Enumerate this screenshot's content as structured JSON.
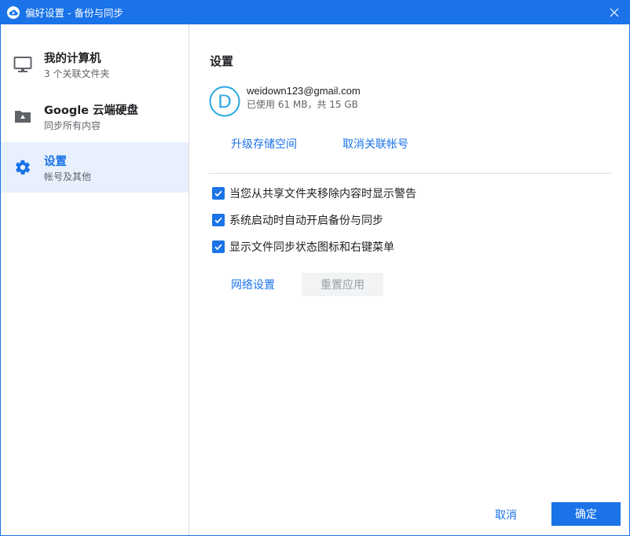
{
  "window": {
    "title": "偏好设置 - 备份与同步",
    "app_icon": "cloud-icon",
    "close_icon": "close-icon"
  },
  "sidebar": {
    "items": [
      {
        "title": "我的计算机",
        "subtitle": "3 个关联文件夹",
        "icon": "monitor-icon",
        "active": false
      },
      {
        "title": "Google 云端硬盘",
        "subtitle": "同步所有内容",
        "icon": "drive-folder-icon",
        "active": false
      },
      {
        "title": "设置",
        "subtitle": "帐号及其他",
        "icon": "gear-icon",
        "active": true
      }
    ]
  },
  "settings": {
    "heading": "设置",
    "account": {
      "email": "weidown123@gmail.com",
      "usage": "已使用 61 MB，共 15 GB",
      "avatar_letter": "D"
    },
    "links": {
      "upgrade": "升级存储空间",
      "disconnect": "取消关联帐号"
    },
    "options": [
      {
        "label": "当您从共享文件夹移除内容时显示警告",
        "checked": true
      },
      {
        "label": "系统启动时自动开启备份与同步",
        "checked": true
      },
      {
        "label": "显示文件同步状态图标和右键菜单",
        "checked": true
      }
    ],
    "network_settings": "网络设置",
    "reset_app": "重置应用"
  },
  "footer": {
    "cancel": "取消",
    "ok": "确定"
  },
  "colors": {
    "accent": "#1a73e8",
    "active_bg": "#e8f0fe",
    "disabled_bg": "#f1f3f4",
    "disabled_text": "#9aa0a6"
  }
}
